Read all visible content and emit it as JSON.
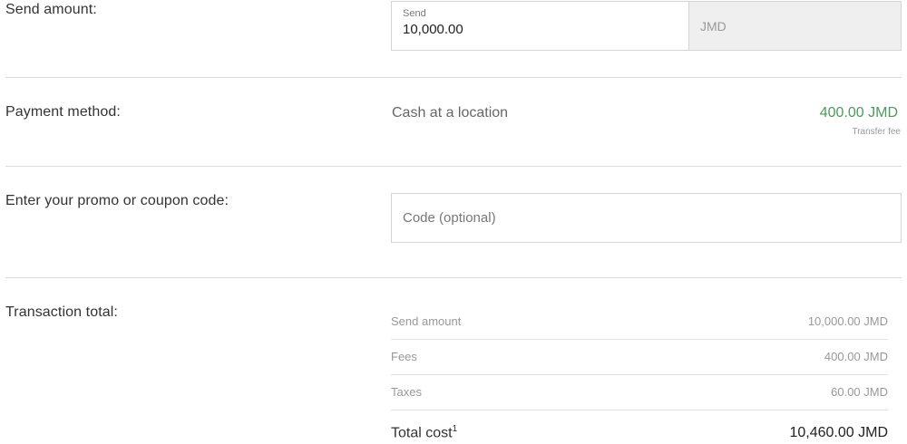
{
  "send": {
    "label": "Send amount:",
    "field_label": "Send",
    "value": "10,000.00",
    "currency": "JMD"
  },
  "payment": {
    "label": "Payment method:",
    "method": "Cash at a location",
    "fee": "400.00 JMD",
    "fee_caption": "Transfer fee"
  },
  "promo": {
    "label": "Enter your promo or coupon code:",
    "placeholder": "Code (optional)",
    "value": ""
  },
  "totals": {
    "label": "Transaction total:",
    "rows": [
      {
        "label": "Send amount",
        "value": "10,000.00 JMD"
      },
      {
        "label": "Fees",
        "value": "400.00 JMD"
      },
      {
        "label": "Taxes",
        "value": "60.00 JMD"
      }
    ],
    "total_label": "Total cost",
    "total_footnote": "1",
    "total_value": "10,460.00 JMD"
  },
  "colors": {
    "fee_green": "#4a9a5e",
    "currency_bg": "#efefef"
  }
}
